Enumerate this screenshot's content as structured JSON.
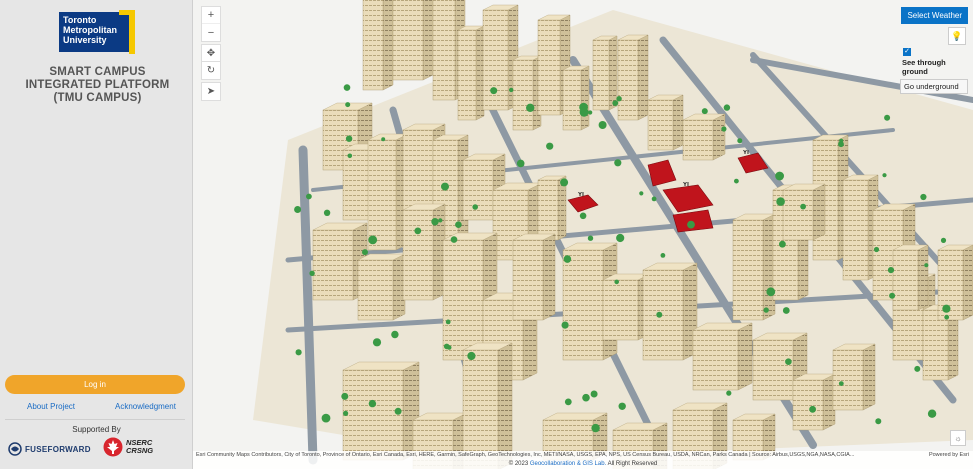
{
  "sidebar": {
    "logo_text": [
      "Toronto",
      "Metropolitan",
      "University"
    ],
    "title": "SMART CAMPUS INTEGRATED PLATFORM (TMU CAMPUS)",
    "login_label": "Log in",
    "about_label": "About Project",
    "ack_label": "Acknowledgment",
    "supported_label": "Supported By",
    "sponsor1": "FUSEFORWARD",
    "sponsor2_line1": "NSERC",
    "sponsor2_line2": "CRSNG"
  },
  "map": {
    "nav_icons": [
      "zoom-in-icon",
      "zoom-out-icon",
      "pan-icon",
      "rotate-icon",
      "compass-icon"
    ],
    "select_weather_label": "Select Weather",
    "see_through_label": "See through ground",
    "see_through_checked": true,
    "go_underground_label": "Go underground",
    "attribution": "Esri Community Maps Contributors, City of Toronto, Province of Ontario, Esri Canada, Esri, HERE, Garmin, SafeGraph, GeoTechnologies, Inc, METI/NASA, USGS, EPA, NPS, US Census Bureau, USDA, NRCan, Parks Canada | Source: Airbus,USGS,NGA,NASA,CGIA...",
    "powered_by": "Powered by Esri",
    "copyright_prefix": "© 2023",
    "copyright_link": "Geocollaboration & GIS Lab.",
    "copyright_suffix": "All Right Reserved",
    "colors": {
      "building": "#efe3c4",
      "building_shadow": "#c9b98f",
      "highlight": "#c0141c",
      "tree": "#3a9a45",
      "road": "#8e99a4",
      "ground": "#f3f3f1",
      "accent": "#0a73c7",
      "login": "#f0a52a"
    }
  }
}
